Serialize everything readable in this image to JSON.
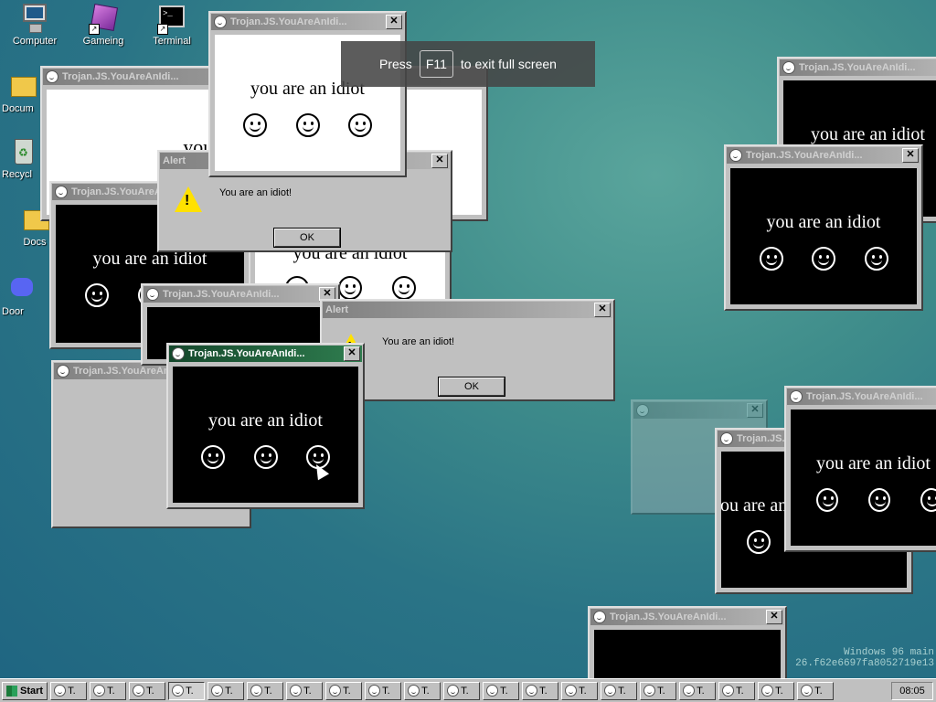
{
  "desktop_icons": [
    {
      "label": "Computer",
      "icon": "computer-icon"
    },
    {
      "label": "Gameing",
      "icon": "game-cube-icon"
    },
    {
      "label": "Terminal",
      "icon": "terminal-icon"
    },
    {
      "label": "Docum",
      "icon": "folder-icon"
    },
    {
      "label": "Recycl",
      "icon": "recycle-bin-icon"
    },
    {
      "label": "Docs",
      "icon": "folder-icon"
    },
    {
      "label": "Door",
      "icon": "discord-icon"
    }
  ],
  "idiot_window": {
    "title": "Trojan.JS.YouAreAnIdi...",
    "message": "you are an idiot"
  },
  "alert": {
    "title": "Alert",
    "message": "You are an idiot!",
    "ok_label": "OK",
    "icon": "warning-icon"
  },
  "fullscreen_toast": {
    "press": "Press",
    "key": "F11",
    "rest": "to exit full screen"
  },
  "watermark": {
    "line1": "Windows 96 main",
    "line2": "26.f62e6697fa8052719e13"
  },
  "taskbar": {
    "start_label": "Start",
    "button_label": "T.",
    "clock": "08:05"
  }
}
